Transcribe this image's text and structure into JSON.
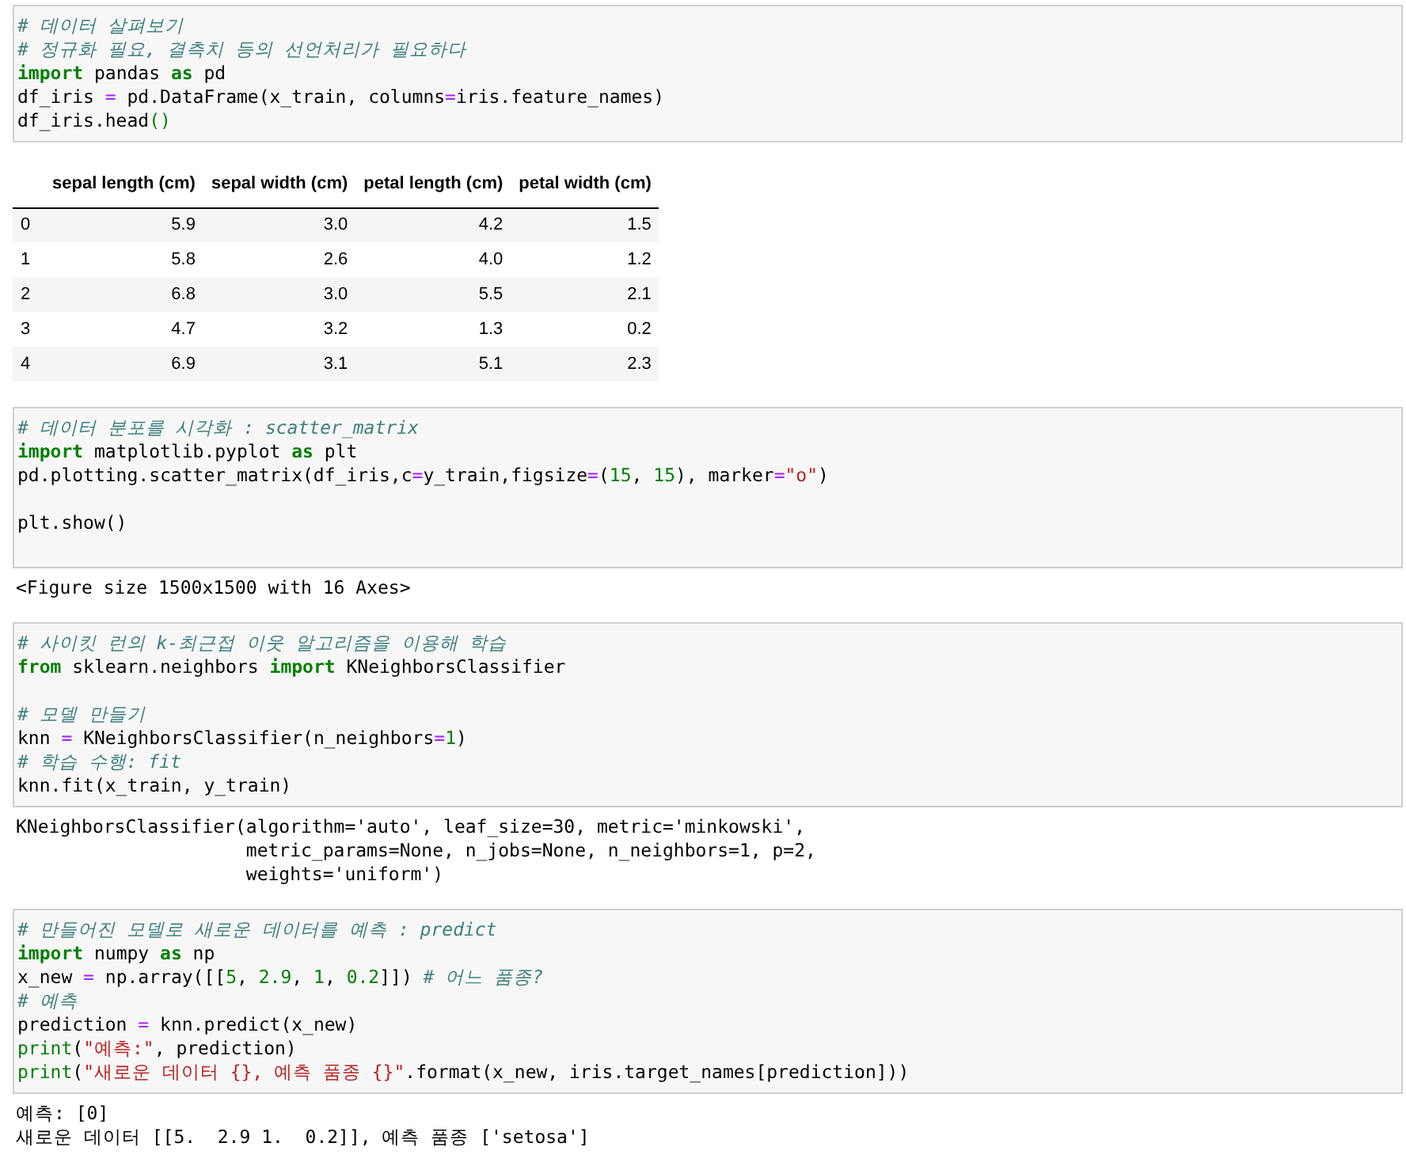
{
  "cells": [
    {
      "kind": "code",
      "lines": [
        {
          "kind": "code",
          "tokens": [
            {
              "kind": "comment",
              "text": "# 데이터 살펴보기"
            }
          ]
        },
        {
          "kind": "code",
          "tokens": [
            {
              "kind": "comment",
              "text": "# 정규화 필요, 결측치 등의 선언처리가 필요하다"
            }
          ]
        },
        {
          "kind": "code",
          "tokens": [
            {
              "kind": "keyword",
              "text": "import"
            },
            {
              "kind": "plain",
              "text": " pandas "
            },
            {
              "kind": "keyword",
              "text": "as"
            },
            {
              "kind": "plain",
              "text": " pd"
            }
          ]
        },
        {
          "kind": "code",
          "tokens": [
            {
              "kind": "plain",
              "text": "df_iris "
            },
            {
              "kind": "operator",
              "text": "="
            },
            {
              "kind": "plain",
              "text": " pd.DataFrame(x_train, columns"
            },
            {
              "kind": "operator",
              "text": "="
            },
            {
              "kind": "plain",
              "text": "iris.feature_names)"
            }
          ]
        },
        {
          "kind": "code",
          "tokens": [
            {
              "kind": "plain",
              "text": "df_iris.head"
            },
            {
              "kind": "number",
              "text": "()"
            }
          ]
        }
      ],
      "output": {
        "kind": "table",
        "columns": [
          "sepal length (cm)",
          "sepal width (cm)",
          "petal length (cm)",
          "petal width (cm)"
        ],
        "rows": [
          {
            "index": "0",
            "values": [
              "5.9",
              "3.0",
              "4.2",
              "1.5"
            ]
          },
          {
            "index": "1",
            "values": [
              "5.8",
              "2.6",
              "4.0",
              "1.2"
            ]
          },
          {
            "index": "2",
            "values": [
              "6.8",
              "3.0",
              "5.5",
              "2.1"
            ]
          },
          {
            "index": "3",
            "values": [
              "4.7",
              "3.2",
              "1.3",
              "0.2"
            ]
          },
          {
            "index": "4",
            "values": [
              "6.9",
              "3.1",
              "5.1",
              "2.3"
            ]
          }
        ]
      }
    },
    {
      "kind": "code",
      "lines": [
        {
          "kind": "code",
          "tokens": [
            {
              "kind": "comment",
              "text": "# 데이터 분포를 시각화 : scatter_matrix"
            }
          ]
        },
        {
          "kind": "code",
          "tokens": [
            {
              "kind": "keyword",
              "text": "import"
            },
            {
              "kind": "plain",
              "text": " matplotlib.pyplot "
            },
            {
              "kind": "keyword",
              "text": "as"
            },
            {
              "kind": "plain",
              "text": " plt"
            }
          ]
        },
        {
          "kind": "code",
          "tokens": [
            {
              "kind": "plain",
              "text": "pd.plotting.scatter_matrix(df_iris,c"
            },
            {
              "kind": "operator",
              "text": "="
            },
            {
              "kind": "plain",
              "text": "y_train,figsize"
            },
            {
              "kind": "operator",
              "text": "="
            },
            {
              "kind": "plain",
              "text": "("
            },
            {
              "kind": "number",
              "text": "15"
            },
            {
              "kind": "plain",
              "text": ", "
            },
            {
              "kind": "number",
              "text": "15"
            },
            {
              "kind": "plain",
              "text": "), marker"
            },
            {
              "kind": "operator",
              "text": "="
            },
            {
              "kind": "string",
              "text": "\"o\""
            },
            {
              "kind": "plain",
              "text": ")"
            }
          ]
        },
        {
          "kind": "blank"
        },
        {
          "kind": "code",
          "tokens": [
            {
              "kind": "plain",
              "text": "plt.show()"
            }
          ]
        },
        {
          "kind": "blank"
        }
      ],
      "output": {
        "kind": "text",
        "lines": [
          "<Figure size 1500x1500 with 16 Axes>"
        ]
      }
    },
    {
      "kind": "code",
      "lines": [
        {
          "kind": "code",
          "tokens": [
            {
              "kind": "comment",
              "text": "# 사이킷 런의 k-최근접 이웃 알고리즘을 이용해 학습"
            }
          ]
        },
        {
          "kind": "code",
          "tokens": [
            {
              "kind": "keyword",
              "text": "from"
            },
            {
              "kind": "plain",
              "text": " sklearn.neighbors "
            },
            {
              "kind": "keyword",
              "text": "import"
            },
            {
              "kind": "plain",
              "text": " KNeighborsClassifier"
            }
          ]
        },
        {
          "kind": "blank"
        },
        {
          "kind": "code",
          "tokens": [
            {
              "kind": "comment",
              "text": "# 모델 만들기"
            }
          ]
        },
        {
          "kind": "code",
          "tokens": [
            {
              "kind": "plain",
              "text": "knn "
            },
            {
              "kind": "operator",
              "text": "="
            },
            {
              "kind": "plain",
              "text": " KNeighborsClassifier(n_neighbors"
            },
            {
              "kind": "operator",
              "text": "="
            },
            {
              "kind": "number",
              "text": "1"
            },
            {
              "kind": "plain",
              "text": ")"
            }
          ]
        },
        {
          "kind": "code",
          "tokens": [
            {
              "kind": "comment",
              "text": "# 학습 수행: fit"
            }
          ]
        },
        {
          "kind": "code",
          "tokens": [
            {
              "kind": "plain",
              "text": "knn.fit(x_train, y_train)"
            }
          ]
        }
      ],
      "output": {
        "kind": "text",
        "lines": [
          "KNeighborsClassifier(algorithm='auto', leaf_size=30, metric='minkowski',",
          "                     metric_params=None, n_jobs=None, n_neighbors=1, p=2,",
          "                     weights='uniform')"
        ]
      }
    },
    {
      "kind": "code",
      "lines": [
        {
          "kind": "code",
          "tokens": [
            {
              "kind": "comment",
              "text": "# 만들어진 모델로 새로운 데이터를 예측 : predict"
            }
          ]
        },
        {
          "kind": "code",
          "tokens": [
            {
              "kind": "keyword",
              "text": "import"
            },
            {
              "kind": "plain",
              "text": " numpy "
            },
            {
              "kind": "keyword",
              "text": "as"
            },
            {
              "kind": "plain",
              "text": " np"
            }
          ]
        },
        {
          "kind": "code",
          "tokens": [
            {
              "kind": "plain",
              "text": "x_new "
            },
            {
              "kind": "operator",
              "text": "="
            },
            {
              "kind": "plain",
              "text": " np.array([["
            },
            {
              "kind": "number",
              "text": "5"
            },
            {
              "kind": "plain",
              "text": ", "
            },
            {
              "kind": "number",
              "text": "2.9"
            },
            {
              "kind": "plain",
              "text": ", "
            },
            {
              "kind": "number",
              "text": "1"
            },
            {
              "kind": "plain",
              "text": ", "
            },
            {
              "kind": "number",
              "text": "0.2"
            },
            {
              "kind": "plain",
              "text": "]]) "
            },
            {
              "kind": "comment",
              "text": "# 어느 품종?"
            }
          ]
        },
        {
          "kind": "code",
          "tokens": [
            {
              "kind": "comment",
              "text": "# 예측"
            }
          ]
        },
        {
          "kind": "code",
          "tokens": [
            {
              "kind": "plain",
              "text": "prediction "
            },
            {
              "kind": "operator",
              "text": "="
            },
            {
              "kind": "plain",
              "text": " knn.predict(x_new)"
            }
          ]
        },
        {
          "kind": "code",
          "tokens": [
            {
              "kind": "builtin",
              "text": "print"
            },
            {
              "kind": "plain",
              "text": "("
            },
            {
              "kind": "string",
              "text": "\"예측:\""
            },
            {
              "kind": "plain",
              "text": ", prediction)"
            }
          ]
        },
        {
          "kind": "code",
          "tokens": [
            {
              "kind": "builtin",
              "text": "print"
            },
            {
              "kind": "plain",
              "text": "("
            },
            {
              "kind": "string",
              "text": "\"새로운 데이터 {}, 예측 품종 {}\""
            },
            {
              "kind": "plain",
              "text": ".format(x_new, iris.target_names[prediction]))"
            }
          ]
        }
      ],
      "output": {
        "kind": "text",
        "lines": [
          "예측: [0]",
          "새로운 데이터 [[5.  2.9 1.  0.2]], 예측 품종 ['setosa']"
        ]
      }
    }
  ]
}
